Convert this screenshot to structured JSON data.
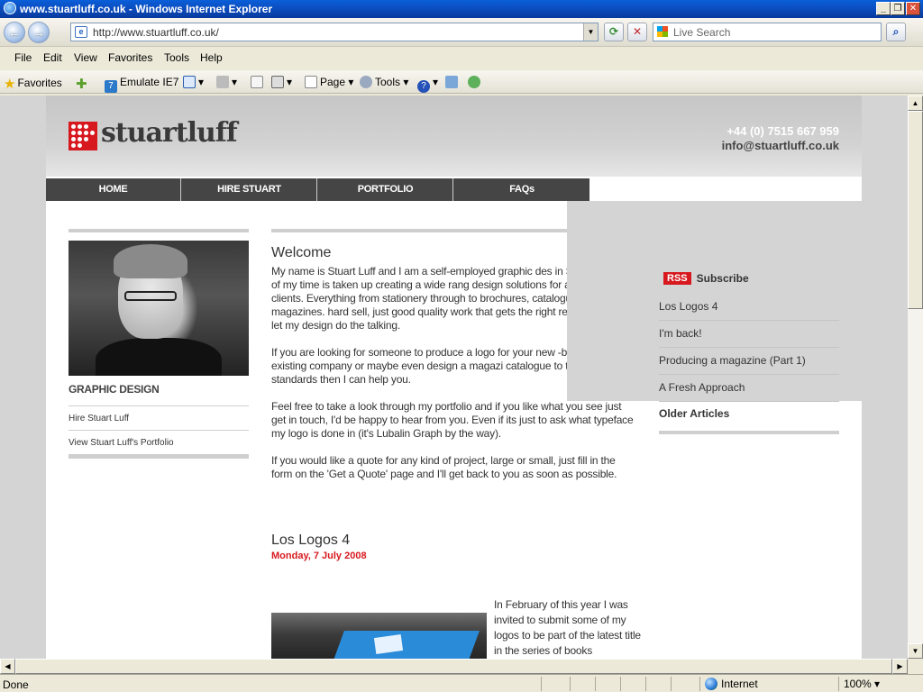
{
  "window": {
    "title": "www.stuartluff.co.uk - Windows Internet Explorer",
    "minimize": "_",
    "restore": "❐",
    "close": "✕"
  },
  "navbar": {
    "back": "←",
    "forward": "→",
    "address": "http://www.stuartluff.co.uk/",
    "refresh": "⟳",
    "stop": "✕",
    "search_placeholder": "Live Search",
    "search_go": "⌕"
  },
  "menu": [
    "File",
    "Edit",
    "View",
    "Favorites",
    "Tools",
    "Help"
  ],
  "favbar": {
    "favorites": "Favorites",
    "emulate": "Emulate IE7",
    "page": "Page",
    "tools": "Tools"
  },
  "site": {
    "brand": "stuartluff",
    "phone": "+44 (0) 7515 667 959",
    "email": "info@stuartluff.co.uk",
    "nav": [
      "HOME",
      "HIRE STUART",
      "PORTFOLIO",
      "FAQs"
    ],
    "left": {
      "heading": "GRAPHIC DESIGN",
      "links": [
        "Hire Stuart Luff",
        "View Stuart Luff's Portfolio"
      ]
    },
    "welcome": {
      "title": "Welcome",
      "p1": "My name is Stuart Luff and I am a self-employed graphic des in Sheffield. Most of my time is taken up creating a wide rang design solutions for a wide range of clients. Everything from stationery through to brochures, catalogues and magazines. hard sell, just good quality work that gets the right results for like to let my design do the talking.",
      "p2": "If you are looking for someone to produce a logo for your new -brand an existing company or maybe even design a magazi catalogue to the highest of standards then I can help you.",
      "p3": "Feel free to take a look through my portfolio and if you like what you see just get in touch, I'd be happy to hear from you. Even if its just to ask what typeface my logo is done in (it's Lubalin Graph by the way).",
      "p4": "If you would like a quote for any kind of project, large or small, just fill in the form on the 'Get a Quote' page and I'll get back to you as soon as possible."
    },
    "post": {
      "title": "Los Logos 4",
      "date": "Monday, 7 July 2008",
      "excerpt": "In February of this year I was invited to submit some of my logos to be part of the latest title in the series of books"
    },
    "right": {
      "rss": "RSS",
      "subscribe": "Subscribe",
      "articles": [
        "Los Logos 4",
        "I'm back!",
        "Producing a magazine (Part 1)",
        "A Fresh Approach"
      ],
      "older": "Older Articles"
    }
  },
  "status": {
    "text": "Done",
    "zone": "Internet",
    "zoom": "100%"
  }
}
